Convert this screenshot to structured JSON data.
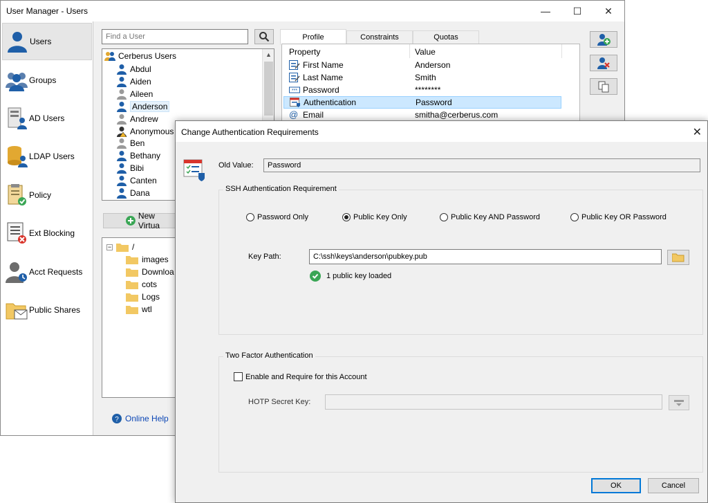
{
  "main_window": {
    "title": "User Manager - Users",
    "controls": {
      "minimize": "—",
      "maximize": "☐",
      "close": "✕"
    }
  },
  "sidebar": {
    "items": [
      {
        "label": "Users",
        "icon": "user-icon",
        "active": true
      },
      {
        "label": "Groups",
        "icon": "group-icon"
      },
      {
        "label": "AD Users",
        "icon": "ad-users-icon"
      },
      {
        "label": "LDAP Users",
        "icon": "ldap-users-icon"
      },
      {
        "label": "Policy",
        "icon": "policy-icon"
      },
      {
        "label": "Ext Blocking",
        "icon": "ext-blocking-icon"
      },
      {
        "label": "Acct Requests",
        "icon": "acct-requests-icon"
      },
      {
        "label": "Public Shares",
        "icon": "public-shares-icon"
      }
    ]
  },
  "search": {
    "placeholder": "Find a User"
  },
  "user_tree": {
    "root": "Cerberus Users",
    "users": [
      "Abdul",
      "Aiden",
      "Aileen",
      "Anderson",
      "Andrew",
      "Anonymous",
      "Ben",
      "Bethany",
      "Bibi",
      "Canten",
      "Dana"
    ],
    "selected": "Anderson"
  },
  "new_virtual_button": "New Virtua",
  "folder_tree": {
    "root": "/",
    "folders": [
      "images",
      "Downloa",
      "cots",
      "Logs",
      "wtl"
    ]
  },
  "online_help": "Online Help",
  "tabs": [
    "Profile",
    "Constraints",
    "Quotas"
  ],
  "properties": {
    "headers": {
      "property": "Property",
      "value": "Value"
    },
    "rows": [
      {
        "name": "First Name",
        "value": "Anderson"
      },
      {
        "name": "Last Name",
        "value": "Smith"
      },
      {
        "name": "Password",
        "value": "********"
      },
      {
        "name": "Authentication",
        "value": "Password",
        "selected": true
      },
      {
        "name": "Email",
        "value": "smitha@cerberus.com"
      }
    ]
  },
  "dialog": {
    "title": "Change Authentication Requirements",
    "close": "✕",
    "old_value_label": "Old Value:",
    "old_value": "Password",
    "ssh_group_title": "SSH Authentication Requirement",
    "radio_options": [
      {
        "label": "Password Only",
        "checked": false
      },
      {
        "label": "Public Key Only",
        "checked": true
      },
      {
        "label": "Public Key AND Password",
        "checked": false
      },
      {
        "label": "Public Key OR Password",
        "checked": false
      }
    ],
    "key_path_label": "Key Path:",
    "key_path_value": "C:\\ssh\\keys\\anderson\\pubkey.pub",
    "key_status": "1 public key loaded",
    "tfa_group_title": "Two Factor Authentication",
    "tfa_checkbox_label": "Enable and Require for this Account",
    "hotp_label": "HOTP Secret Key:",
    "ok": "OK",
    "cancel": "Cancel"
  },
  "colors": {
    "accent": "#0078d7",
    "selection": "#cce8ff",
    "user_icon_blue": "#1f5fa8",
    "success_green": "#3aa655",
    "link_blue": "#0b46b5"
  }
}
